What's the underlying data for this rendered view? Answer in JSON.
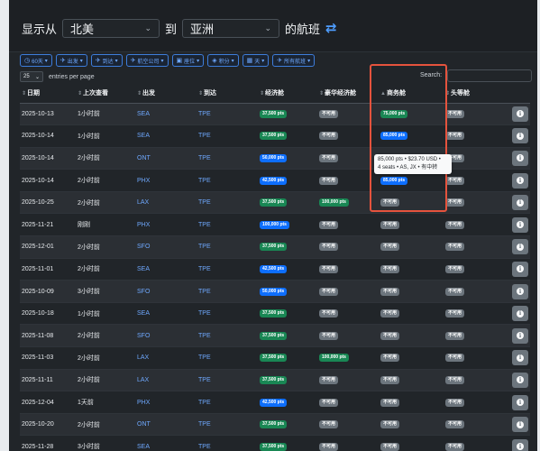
{
  "route": {
    "show_from_label": "显示从",
    "from_value": "北美",
    "to_label": "到",
    "to_value": "亚洲",
    "flights_label": "的航班"
  },
  "filters": [
    {
      "icon": "clock-icon",
      "glyph": "◷",
      "label": "60天"
    },
    {
      "icon": "plane-departure-icon",
      "glyph": "✈",
      "label": "出发"
    },
    {
      "icon": "plane-arrival-icon",
      "glyph": "✈",
      "label": "到达"
    },
    {
      "icon": "airline-icon",
      "glyph": "✈",
      "label": "航空公司"
    },
    {
      "icon": "seat-icon",
      "glyph": "▣",
      "label": "座位"
    },
    {
      "icon": "points-icon",
      "glyph": "◈",
      "label": "积分"
    },
    {
      "icon": "calendar-icon",
      "glyph": "▦",
      "label": "天"
    },
    {
      "icon": "all-flights-icon",
      "glyph": "✈",
      "label": "所有航班"
    }
  ],
  "length": {
    "value": "25",
    "label": "entries per page"
  },
  "search": {
    "label": "Search:",
    "value": ""
  },
  "columns": [
    "日期",
    "上次查看",
    "出发",
    "到达",
    "经济舱",
    "豪华经济舱",
    "商务舱",
    "头等舱"
  ],
  "rows": [
    {
      "date": "2025-10-13",
      "last": "1小时前",
      "from": "SEA",
      "to": "TPE",
      "eco": "37,500 pts",
      "eco_c": "green",
      "prem": "不可用",
      "prem_c": "gray",
      "biz": "75,000 pts",
      "biz_c": "green",
      "first": "不可用"
    },
    {
      "date": "2025-10-14",
      "last": "1小时前",
      "from": "SEA",
      "to": "TPE",
      "eco": "37,500 pts",
      "eco_c": "green",
      "prem": "不可用",
      "prem_c": "gray",
      "biz": "85,000 pts",
      "biz_c": "blue",
      "first": "不可用"
    },
    {
      "date": "2025-10-14",
      "last": "2小时前",
      "from": "ONT",
      "to": "TPE",
      "eco": "50,000 pts",
      "eco_c": "blue",
      "prem": "不可用",
      "prem_c": "gray",
      "biz": "",
      "biz_c": "",
      "first": "不可用"
    },
    {
      "date": "2025-10-14",
      "last": "2小时前",
      "from": "PHX",
      "to": "TPE",
      "eco": "42,500 pts",
      "eco_c": "blue",
      "prem": "不可用",
      "prem_c": "gray",
      "biz": "85,000 pts",
      "biz_c": "blue",
      "first": "不可用"
    },
    {
      "date": "2025-10-25",
      "last": "2小时前",
      "from": "LAX",
      "to": "TPE",
      "eco": "37,500 pts",
      "eco_c": "green",
      "prem": "100,000 pts",
      "prem_c": "green",
      "biz": "不可用",
      "biz_c": "gray",
      "first": "不可用"
    },
    {
      "date": "2025-11-21",
      "last": "刚刚",
      "from": "PHX",
      "to": "TPE",
      "eco": "100,000 pts",
      "eco_c": "blue",
      "prem": "不可用",
      "prem_c": "gray",
      "biz": "不可用",
      "biz_c": "gray",
      "first": "不可用"
    },
    {
      "date": "2025-12-01",
      "last": "2小时前",
      "from": "SFO",
      "to": "TPE",
      "eco": "37,500 pts",
      "eco_c": "green",
      "prem": "不可用",
      "prem_c": "gray",
      "biz": "不可用",
      "biz_c": "gray",
      "first": "不可用"
    },
    {
      "date": "2025-11-01",
      "last": "2小时前",
      "from": "SEA",
      "to": "TPE",
      "eco": "42,500 pts",
      "eco_c": "blue",
      "prem": "不可用",
      "prem_c": "gray",
      "biz": "不可用",
      "biz_c": "gray",
      "first": "不可用"
    },
    {
      "date": "2025-10-09",
      "last": "3小时前",
      "from": "SFO",
      "to": "TPE",
      "eco": "50,000 pts",
      "eco_c": "blue",
      "prem": "不可用",
      "prem_c": "gray",
      "biz": "不可用",
      "biz_c": "gray",
      "first": "不可用"
    },
    {
      "date": "2025-10-18",
      "last": "1小时前",
      "from": "SEA",
      "to": "TPE",
      "eco": "37,500 pts",
      "eco_c": "green",
      "prem": "不可用",
      "prem_c": "gray",
      "biz": "不可用",
      "biz_c": "gray",
      "first": "不可用"
    },
    {
      "date": "2025-11-08",
      "last": "2小时前",
      "from": "SFO",
      "to": "TPE",
      "eco": "37,500 pts",
      "eco_c": "green",
      "prem": "不可用",
      "prem_c": "gray",
      "biz": "不可用",
      "biz_c": "gray",
      "first": "不可用"
    },
    {
      "date": "2025-11-03",
      "last": "2小时前",
      "from": "LAX",
      "to": "TPE",
      "eco": "37,500 pts",
      "eco_c": "green",
      "prem": "100,000 pts",
      "prem_c": "green",
      "biz": "不可用",
      "biz_c": "gray",
      "first": "不可用"
    },
    {
      "date": "2025-11-11",
      "last": "2小时前",
      "from": "LAX",
      "to": "TPE",
      "eco": "37,500 pts",
      "eco_c": "green",
      "prem": "不可用",
      "prem_c": "gray",
      "biz": "不可用",
      "biz_c": "gray",
      "first": "不可用"
    },
    {
      "date": "2025-12-04",
      "last": "1天前",
      "from": "PHX",
      "to": "TPE",
      "eco": "42,500 pts",
      "eco_c": "blue",
      "prem": "不可用",
      "prem_c": "gray",
      "biz": "不可用",
      "biz_c": "gray",
      "first": "不可用"
    },
    {
      "date": "2025-10-20",
      "last": "2小时前",
      "from": "ONT",
      "to": "TPE",
      "eco": "37,500 pts",
      "eco_c": "green",
      "prem": "不可用",
      "prem_c": "gray",
      "biz": "不可用",
      "biz_c": "gray",
      "first": "不可用"
    },
    {
      "date": "2025-11-28",
      "last": "3小时前",
      "from": "SEA",
      "to": "TPE",
      "eco": "37,500 pts",
      "eco_c": "green",
      "prem": "不可用",
      "prem_c": "gray",
      "biz": "不可用",
      "biz_c": "gray",
      "first": "不可用"
    }
  ],
  "tooltip": {
    "line1": "85,000 pts • $23.70 USD •",
    "line2": "4 seats • AS, JX • 有中转"
  },
  "colors": {
    "accent": "#0d6efd",
    "success": "#198754",
    "muted": "#6c757d",
    "highlight": "#e5533d"
  }
}
